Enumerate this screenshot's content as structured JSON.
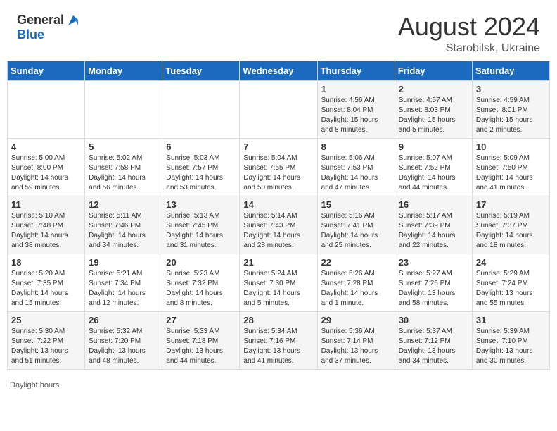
{
  "header": {
    "logo_general": "General",
    "logo_blue": "Blue",
    "month_year": "August 2024",
    "location": "Starobilsk, Ukraine"
  },
  "days_of_week": [
    "Sunday",
    "Monday",
    "Tuesday",
    "Wednesday",
    "Thursday",
    "Friday",
    "Saturday"
  ],
  "weeks": [
    [
      {
        "day": "",
        "sunrise": "",
        "sunset": "",
        "daylight": ""
      },
      {
        "day": "",
        "sunrise": "",
        "sunset": "",
        "daylight": ""
      },
      {
        "day": "",
        "sunrise": "",
        "sunset": "",
        "daylight": ""
      },
      {
        "day": "",
        "sunrise": "",
        "sunset": "",
        "daylight": ""
      },
      {
        "day": "1",
        "sunrise": "Sunrise: 4:56 AM",
        "sunset": "Sunset: 8:04 PM",
        "daylight": "Daylight: 15 hours and 8 minutes."
      },
      {
        "day": "2",
        "sunrise": "Sunrise: 4:57 AM",
        "sunset": "Sunset: 8:03 PM",
        "daylight": "Daylight: 15 hours and 5 minutes."
      },
      {
        "day": "3",
        "sunrise": "Sunrise: 4:59 AM",
        "sunset": "Sunset: 8:01 PM",
        "daylight": "Daylight: 15 hours and 2 minutes."
      }
    ],
    [
      {
        "day": "4",
        "sunrise": "Sunrise: 5:00 AM",
        "sunset": "Sunset: 8:00 PM",
        "daylight": "Daylight: 14 hours and 59 minutes."
      },
      {
        "day": "5",
        "sunrise": "Sunrise: 5:02 AM",
        "sunset": "Sunset: 7:58 PM",
        "daylight": "Daylight: 14 hours and 56 minutes."
      },
      {
        "day": "6",
        "sunrise": "Sunrise: 5:03 AM",
        "sunset": "Sunset: 7:57 PM",
        "daylight": "Daylight: 14 hours and 53 minutes."
      },
      {
        "day": "7",
        "sunrise": "Sunrise: 5:04 AM",
        "sunset": "Sunset: 7:55 PM",
        "daylight": "Daylight: 14 hours and 50 minutes."
      },
      {
        "day": "8",
        "sunrise": "Sunrise: 5:06 AM",
        "sunset": "Sunset: 7:53 PM",
        "daylight": "Daylight: 14 hours and 47 minutes."
      },
      {
        "day": "9",
        "sunrise": "Sunrise: 5:07 AM",
        "sunset": "Sunset: 7:52 PM",
        "daylight": "Daylight: 14 hours and 44 minutes."
      },
      {
        "day": "10",
        "sunrise": "Sunrise: 5:09 AM",
        "sunset": "Sunset: 7:50 PM",
        "daylight": "Daylight: 14 hours and 41 minutes."
      }
    ],
    [
      {
        "day": "11",
        "sunrise": "Sunrise: 5:10 AM",
        "sunset": "Sunset: 7:48 PM",
        "daylight": "Daylight: 14 hours and 38 minutes."
      },
      {
        "day": "12",
        "sunrise": "Sunrise: 5:11 AM",
        "sunset": "Sunset: 7:46 PM",
        "daylight": "Daylight: 14 hours and 34 minutes."
      },
      {
        "day": "13",
        "sunrise": "Sunrise: 5:13 AM",
        "sunset": "Sunset: 7:45 PM",
        "daylight": "Daylight: 14 hours and 31 minutes."
      },
      {
        "day": "14",
        "sunrise": "Sunrise: 5:14 AM",
        "sunset": "Sunset: 7:43 PM",
        "daylight": "Daylight: 14 hours and 28 minutes."
      },
      {
        "day": "15",
        "sunrise": "Sunrise: 5:16 AM",
        "sunset": "Sunset: 7:41 PM",
        "daylight": "Daylight: 14 hours and 25 minutes."
      },
      {
        "day": "16",
        "sunrise": "Sunrise: 5:17 AM",
        "sunset": "Sunset: 7:39 PM",
        "daylight": "Daylight: 14 hours and 22 minutes."
      },
      {
        "day": "17",
        "sunrise": "Sunrise: 5:19 AM",
        "sunset": "Sunset: 7:37 PM",
        "daylight": "Daylight: 14 hours and 18 minutes."
      }
    ],
    [
      {
        "day": "18",
        "sunrise": "Sunrise: 5:20 AM",
        "sunset": "Sunset: 7:35 PM",
        "daylight": "Daylight: 14 hours and 15 minutes."
      },
      {
        "day": "19",
        "sunrise": "Sunrise: 5:21 AM",
        "sunset": "Sunset: 7:34 PM",
        "daylight": "Daylight: 14 hours and 12 minutes."
      },
      {
        "day": "20",
        "sunrise": "Sunrise: 5:23 AM",
        "sunset": "Sunset: 7:32 PM",
        "daylight": "Daylight: 14 hours and 8 minutes."
      },
      {
        "day": "21",
        "sunrise": "Sunrise: 5:24 AM",
        "sunset": "Sunset: 7:30 PM",
        "daylight": "Daylight: 14 hours and 5 minutes."
      },
      {
        "day": "22",
        "sunrise": "Sunrise: 5:26 AM",
        "sunset": "Sunset: 7:28 PM",
        "daylight": "Daylight: 14 hours and 1 minute."
      },
      {
        "day": "23",
        "sunrise": "Sunrise: 5:27 AM",
        "sunset": "Sunset: 7:26 PM",
        "daylight": "Daylight: 13 hours and 58 minutes."
      },
      {
        "day": "24",
        "sunrise": "Sunrise: 5:29 AM",
        "sunset": "Sunset: 7:24 PM",
        "daylight": "Daylight: 13 hours and 55 minutes."
      }
    ],
    [
      {
        "day": "25",
        "sunrise": "Sunrise: 5:30 AM",
        "sunset": "Sunset: 7:22 PM",
        "daylight": "Daylight: 13 hours and 51 minutes."
      },
      {
        "day": "26",
        "sunrise": "Sunrise: 5:32 AM",
        "sunset": "Sunset: 7:20 PM",
        "daylight": "Daylight: 13 hours and 48 minutes."
      },
      {
        "day": "27",
        "sunrise": "Sunrise: 5:33 AM",
        "sunset": "Sunset: 7:18 PM",
        "daylight": "Daylight: 13 hours and 44 minutes."
      },
      {
        "day": "28",
        "sunrise": "Sunrise: 5:34 AM",
        "sunset": "Sunset: 7:16 PM",
        "daylight": "Daylight: 13 hours and 41 minutes."
      },
      {
        "day": "29",
        "sunrise": "Sunrise: 5:36 AM",
        "sunset": "Sunset: 7:14 PM",
        "daylight": "Daylight: 13 hours and 37 minutes."
      },
      {
        "day": "30",
        "sunrise": "Sunrise: 5:37 AM",
        "sunset": "Sunset: 7:12 PM",
        "daylight": "Daylight: 13 hours and 34 minutes."
      },
      {
        "day": "31",
        "sunrise": "Sunrise: 5:39 AM",
        "sunset": "Sunset: 7:10 PM",
        "daylight": "Daylight: 13 hours and 30 minutes."
      }
    ]
  ],
  "footer": {
    "note": "Daylight hours"
  }
}
